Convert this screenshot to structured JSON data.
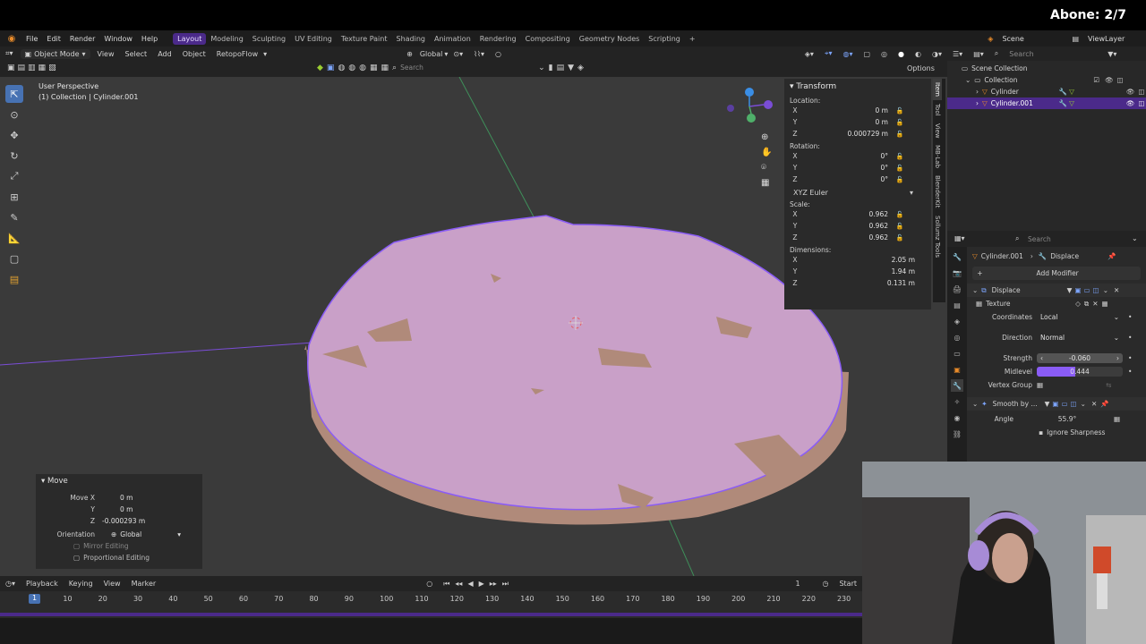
{
  "stream": {
    "sub_goal": "Abone: 2/7"
  },
  "menu": {
    "items": [
      "File",
      "Edit",
      "Render",
      "Window",
      "Help"
    ],
    "workspaces": [
      "Layout",
      "Modeling",
      "Sculpting",
      "UV Editing",
      "Texture Paint",
      "Shading",
      "Animation",
      "Rendering",
      "Compositing",
      "Geometry Nodes",
      "Scripting"
    ],
    "active_workspace": "Layout",
    "scene": "Scene",
    "view_layer": "ViewLayer"
  },
  "viewport_header": {
    "mode": "Object Mode",
    "menus": [
      "View",
      "Select",
      "Add",
      "Object",
      "RetopoFlow"
    ],
    "orientation": "Global",
    "search_placeholder": "Search",
    "options": "Options"
  },
  "viewport": {
    "perspective": "User Perspective",
    "collection_info": "(1) Collection | Cylinder.001"
  },
  "transform": {
    "title": "Transform",
    "location_label": "Location:",
    "location": {
      "x": "0 m",
      "y": "0 m",
      "z": "0.000729 m"
    },
    "rotation_label": "Rotation:",
    "rotation": {
      "x": "0°",
      "y": "0°",
      "z": "0°"
    },
    "rotation_mode": "XYZ Euler",
    "scale_label": "Scale:",
    "scale": {
      "x": "0.962",
      "y": "0.962",
      "z": "0.962"
    },
    "dimensions_label": "Dimensions:",
    "dimensions": {
      "x": "2.05 m",
      "y": "1.94 m",
      "z": "0.131 m"
    }
  },
  "side_tabs": [
    "Item",
    "Tool",
    "View",
    "MB-Lab",
    "BlenderKit",
    "Sollumz Tools"
  ],
  "move_panel": {
    "title": "Move",
    "move_x_label": "Move X",
    "move_x": "0 m",
    "y": "0 m",
    "z": "-0.000293 m",
    "orientation_label": "Orientation",
    "orientation": "Global",
    "mirror": "Mirror Editing",
    "proportional": "Proportional Editing"
  },
  "timeline": {
    "menus": [
      "Playback",
      "Keying",
      "View",
      "Marker"
    ],
    "current_frame": "1",
    "start_label": "Start",
    "ticks": [
      "1",
      "10",
      "20",
      "30",
      "40",
      "50",
      "60",
      "70",
      "80",
      "90",
      "100",
      "110",
      "120",
      "130",
      "140",
      "150",
      "160",
      "170",
      "180",
      "190",
      "200",
      "210",
      "220",
      "230"
    ]
  },
  "outliner": {
    "search_placeholder": "Search",
    "root": "Scene Collection",
    "collection": "Collection",
    "objects": [
      "Cylinder",
      "Cylinder.001"
    ],
    "selected": "Cylinder.001"
  },
  "properties": {
    "search_placeholder": "Search",
    "breadcrumb_object": "Cylinder.001",
    "breadcrumb_modifier": "Displace",
    "add_modifier": "Add Modifier",
    "displace_name": "Displace",
    "texture_label": "Texture",
    "coordinates_label": "Coordinates",
    "coordinates": "Local",
    "direction_label": "Direction",
    "direction": "Normal",
    "strength_label": "Strength",
    "strength": "-0.060",
    "midlevel_label": "Midlevel",
    "midlevel": "0.444",
    "midlevel_fraction": 0.444,
    "vertex_group_label": "Vertex Group",
    "smooth_name": "Smooth by ...",
    "angle_label": "Angle",
    "angle": "55.9°",
    "ignore_sharpness": "Ignore Sharpness"
  },
  "colors": {
    "accent": "#4b2a8a",
    "selection_purple": "#8a5cf6",
    "mesh_pink": "#c9a0c8",
    "mesh_tan": "#b08a7a"
  }
}
